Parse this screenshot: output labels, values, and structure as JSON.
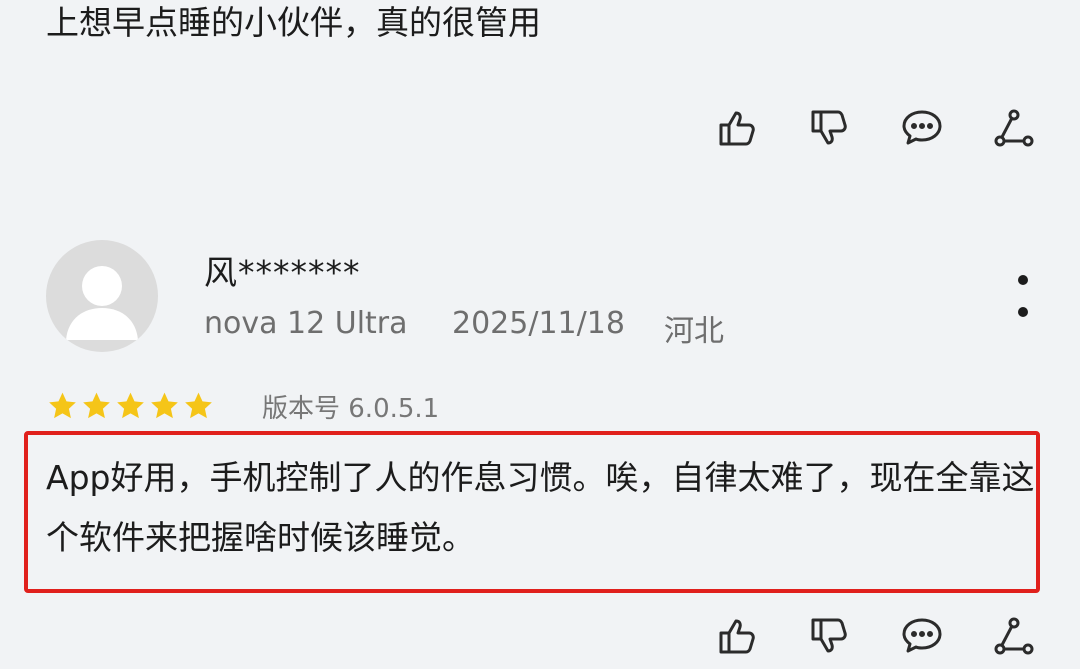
{
  "previous_review": {
    "text_tail": "上想早点睡的小伙伴，真的很管用",
    "actions": [
      "like-icon",
      "dislike-icon",
      "comment-icon",
      "share-icon"
    ]
  },
  "review": {
    "username": "风*******",
    "device": "nova 12 Ultra",
    "date": "2025/11/18",
    "region": "河北",
    "rating": 5,
    "rating_max": 5,
    "version_label": "版本号 6.0.5.1",
    "text": "App好用，手机控制了人的作息习惯。唉，自律太难了，现在全靠这个软件来把握啥时候该睡觉。",
    "highlight_color": "#e0201c",
    "star_color": "#f5c518",
    "actions": [
      "like-icon",
      "dislike-icon",
      "comment-icon",
      "share-icon"
    ]
  }
}
